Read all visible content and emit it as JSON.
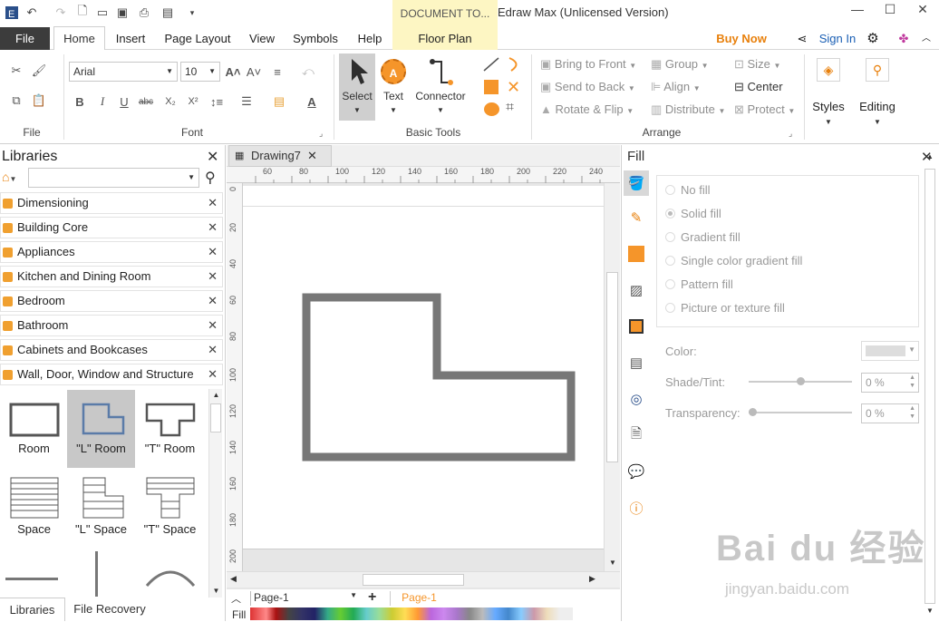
{
  "app": {
    "doc_tab": "DOCUMENT TO...",
    "window_title": "Edraw Max (Unlicensed Version)"
  },
  "menu": {
    "file": "File",
    "home": "Home",
    "insert": "Insert",
    "page_layout": "Page Layout",
    "view": "View",
    "symbols": "Symbols",
    "help": "Help",
    "floor_plan": "Floor Plan",
    "buy_now": "Buy Now",
    "sign_in": "Sign In"
  },
  "ribbon": {
    "file_group": "File",
    "font_name": "Arial",
    "font_size": "10",
    "font_group": "Font",
    "select": "Select",
    "text": "Text",
    "connector": "Connector",
    "basic_tools": "Basic Tools",
    "bring_front": "Bring to Front",
    "send_back": "Send to Back",
    "rotate_flip": "Rotate & Flip",
    "group": "Group",
    "align": "Align",
    "distribute": "Distribute",
    "size": "Size",
    "center": "Center",
    "protect": "Protect",
    "arrange": "Arrange",
    "styles": "Styles",
    "editing": "Editing"
  },
  "libraries": {
    "title": "Libraries",
    "items": [
      "Dimensioning",
      "Building Core",
      "Appliances",
      "Kitchen and Dining Room",
      "Bedroom",
      "Bathroom",
      "Cabinets and Bookcases",
      "Wall, Door, Window and Structure"
    ],
    "shapes": [
      "Room",
      "\"L\" Room",
      "\"T\" Room",
      "Space",
      "\"L\" Space",
      "\"T\" Space"
    ],
    "tab_libraries": "Libraries",
    "tab_recovery": "File Recovery"
  },
  "canvas": {
    "tab": "Drawing7",
    "h_ticks": [
      "60",
      "80",
      "100",
      "120",
      "140",
      "160",
      "180",
      "200",
      "220",
      "240"
    ],
    "v_ticks": [
      "0",
      "20",
      "40",
      "60",
      "80",
      "100",
      "120",
      "140",
      "160",
      "180",
      "200"
    ]
  },
  "fill": {
    "title": "Fill",
    "options": [
      "No fill",
      "Solid fill",
      "Gradient fill",
      "Single color gradient fill",
      "Pattern fill",
      "Picture or texture fill"
    ],
    "color_label": "Color:",
    "shade_label": "Shade/Tint:",
    "shade_value": "0 %",
    "transparency_label": "Transparency:",
    "transparency_value": "0 %"
  },
  "bottom": {
    "page_select": "Page-1",
    "page_tab": "Page-1",
    "fill_label": "Fill"
  },
  "colors": {
    "accent": "#f5952a",
    "buy": "#e8800c",
    "link": "#1a5fb4"
  },
  "watermark": {
    "text": "Bai du 经验",
    "sub": "jingyan.baidu.com"
  }
}
